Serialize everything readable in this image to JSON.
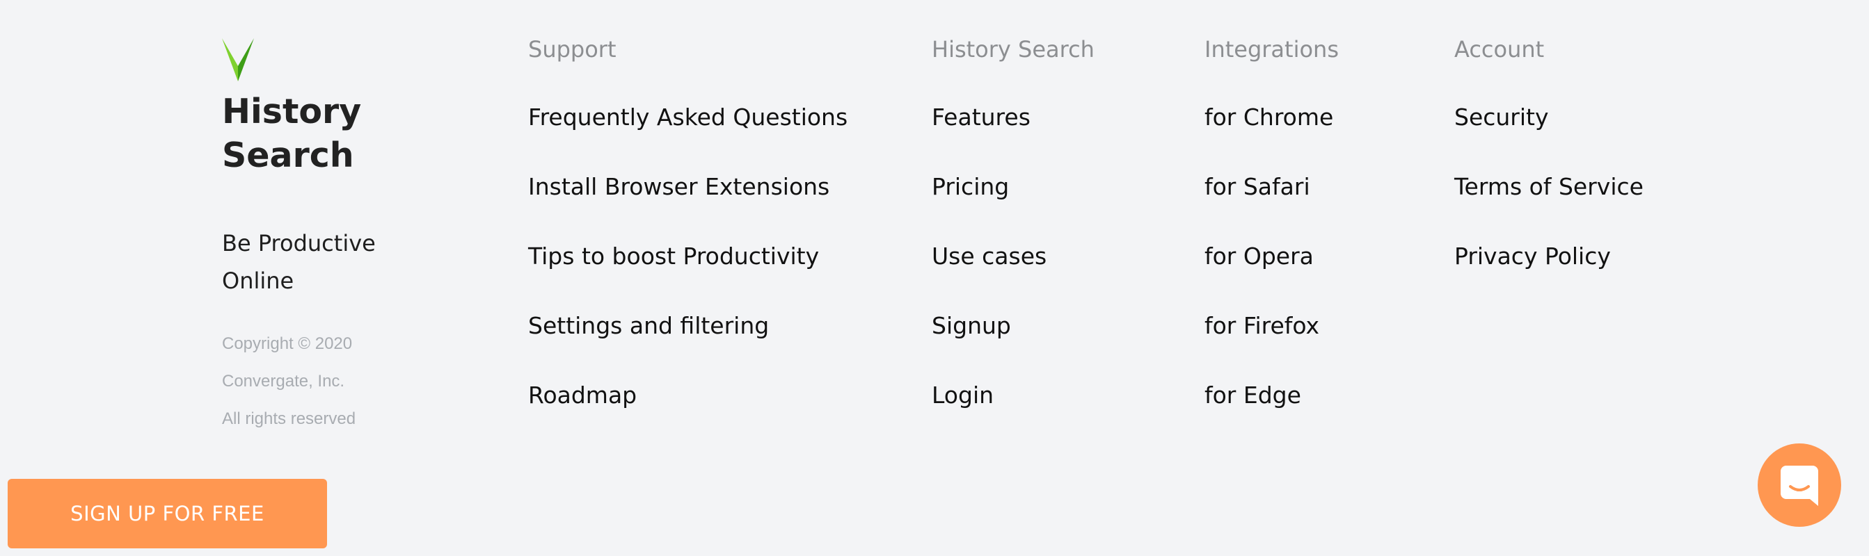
{
  "brand": {
    "name": "History Search",
    "tagline": "Be Productive Online",
    "logo_icon": "green-v-chevron-icon",
    "logo_colors": {
      "light": "#7fd12f",
      "dark": "#3e9e17"
    },
    "legal": [
      "Copyright © 2020",
      "Convergate, Inc.",
      "All rights reserved"
    ]
  },
  "columns": {
    "support": {
      "heading": "Support",
      "links": [
        "Frequently Asked Questions",
        "Install Browser Extensions",
        "Tips to boost Productivity",
        "Settings and filtering",
        "Roadmap"
      ]
    },
    "product": {
      "heading": "History Search",
      "links": [
        "Features",
        "Pricing",
        "Use cases",
        "Signup",
        "Login"
      ]
    },
    "integrations": {
      "heading": "Integrations",
      "links": [
        "for Chrome",
        "for Safari",
        "for Opera",
        "for Firefox",
        "for Edge"
      ]
    },
    "account": {
      "heading": "Account",
      "links": [
        "Security",
        "Terms of Service",
        "Privacy Policy"
      ]
    }
  },
  "cta": {
    "label": "SIGN UP FOR FREE",
    "color": "#ff9751"
  },
  "chat": {
    "icon": "chat-bubble-icon",
    "color": "#ff9751"
  }
}
